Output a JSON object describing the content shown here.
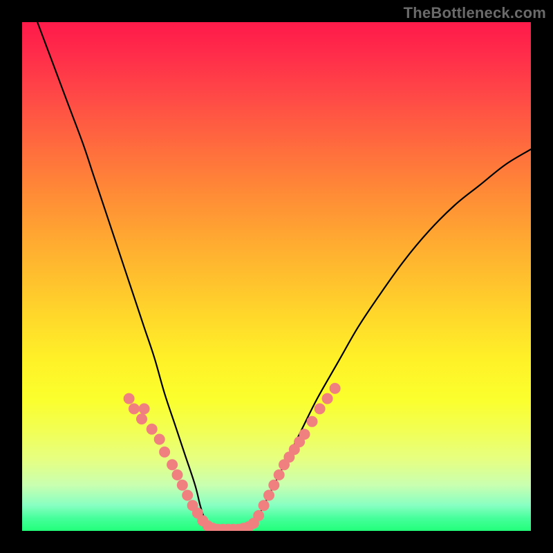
{
  "watermark": "TheBottleneck.com",
  "colors": {
    "background_frame": "#000000",
    "curve_stroke": "#000000",
    "marker_fill": "#f08080",
    "gradient_stops": [
      "#ff1a4a",
      "#ff2b4a",
      "#ff4747",
      "#ff6a3e",
      "#ff8c36",
      "#ffb030",
      "#ffd22b",
      "#fff028",
      "#fbff2c",
      "#f2ff52",
      "#e6ff82",
      "#c9ffb0",
      "#87ffc2",
      "#46ff9b",
      "#22ff7a"
    ]
  },
  "chart_data": {
    "type": "line",
    "title": "",
    "xlabel": "",
    "ylabel": "",
    "xlim": [
      0,
      100
    ],
    "ylim": [
      0,
      100
    ],
    "grid": false,
    "legend": false,
    "note": "No axis ticks or numeric labels are rendered; values are normalized 0–100 estimates read from pixel positions.",
    "series": [
      {
        "name": "left-curve",
        "x": [
          3,
          6,
          9,
          12,
          14,
          16,
          18,
          20,
          22,
          24,
          26,
          28,
          30,
          32,
          34,
          35,
          36,
          37
        ],
        "values": [
          100,
          92,
          84,
          76,
          70,
          64,
          58,
          52,
          46,
          40,
          34,
          27,
          21,
          15,
          9,
          5,
          2,
          0
        ]
      },
      {
        "name": "valley-floor",
        "x": [
          37,
          38,
          39,
          40,
          41,
          42,
          43,
          44,
          45
        ],
        "values": [
          0,
          0,
          0,
          0,
          0,
          0,
          0,
          0,
          0
        ]
      },
      {
        "name": "right-curve",
        "x": [
          45,
          47,
          49,
          52,
          55,
          58,
          62,
          66,
          70,
          75,
          80,
          85,
          90,
          95,
          100
        ],
        "values": [
          0,
          4,
          8,
          14,
          20,
          26,
          33,
          40,
          46,
          53,
          59,
          64,
          68,
          72,
          75
        ]
      }
    ],
    "markers": [
      {
        "name": "left-dot-cluster",
        "points": [
          {
            "x": 21.0,
            "y": 26.0
          },
          {
            "x": 22.0,
            "y": 24.0
          },
          {
            "x": 24.0,
            "y": 24.0
          },
          {
            "x": 23.5,
            "y": 22.0
          },
          {
            "x": 25.5,
            "y": 20.0
          },
          {
            "x": 27.0,
            "y": 18.0
          },
          {
            "x": 28.0,
            "y": 15.5
          },
          {
            "x": 29.5,
            "y": 13.0
          },
          {
            "x": 30.5,
            "y": 11.0
          },
          {
            "x": 31.5,
            "y": 9.0
          },
          {
            "x": 32.5,
            "y": 7.0
          },
          {
            "x": 33.5,
            "y": 5.0
          },
          {
            "x": 34.5,
            "y": 3.5
          },
          {
            "x": 35.5,
            "y": 2.0
          }
        ]
      },
      {
        "name": "valley-dot-cluster",
        "points": [
          {
            "x": 36.5,
            "y": 1.0
          },
          {
            "x": 37.5,
            "y": 0.5
          },
          {
            "x": 38.5,
            "y": 0.3
          },
          {
            "x": 39.5,
            "y": 0.3
          },
          {
            "x": 40.5,
            "y": 0.3
          },
          {
            "x": 41.5,
            "y": 0.3
          },
          {
            "x": 42.5,
            "y": 0.3
          },
          {
            "x": 43.5,
            "y": 0.5
          },
          {
            "x": 44.5,
            "y": 0.8
          }
        ]
      },
      {
        "name": "right-dot-cluster",
        "points": [
          {
            "x": 45.5,
            "y": 1.5
          },
          {
            "x": 46.5,
            "y": 3.0
          },
          {
            "x": 47.5,
            "y": 5.0
          },
          {
            "x": 48.5,
            "y": 7.0
          },
          {
            "x": 49.5,
            "y": 9.0
          },
          {
            "x": 50.5,
            "y": 11.0
          },
          {
            "x": 51.5,
            "y": 13.0
          },
          {
            "x": 52.5,
            "y": 14.5
          },
          {
            "x": 53.5,
            "y": 16.0
          },
          {
            "x": 54.5,
            "y": 17.5
          },
          {
            "x": 55.5,
            "y": 19.0
          },
          {
            "x": 57.0,
            "y": 21.5
          },
          {
            "x": 58.5,
            "y": 24.0
          },
          {
            "x": 60.0,
            "y": 26.0
          },
          {
            "x": 61.5,
            "y": 28.0
          }
        ]
      }
    ]
  }
}
